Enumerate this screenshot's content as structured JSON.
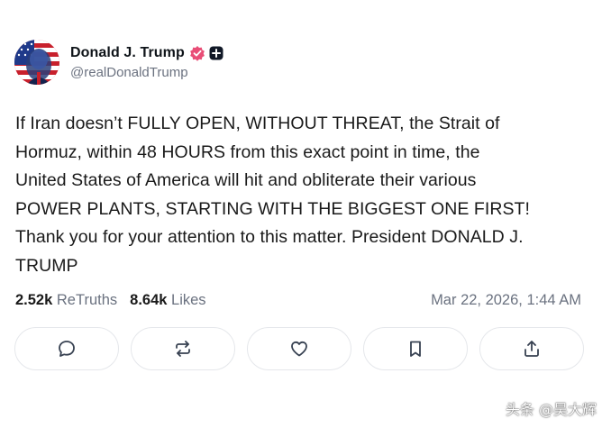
{
  "post": {
    "author": {
      "display_name": "Donald J. Trump",
      "handle": "@realDonaldTrump",
      "verified_badge": "verified-check-icon",
      "verified_color": "#e94e77",
      "plus_badge": "plus-badge-icon"
    },
    "body_lines": [
      "If Iran doesn’t FULLY OPEN, WITHOUT THREAT, the Strait of",
      "Hormuz, within 48 HOURS from this exact point in time, the",
      "United States of America will hit and obliterate their various",
      "POWER PLANTS, STARTING WITH THE BIGGEST ONE FIRST!",
      "Thank you for your attention to this matter. President DONALD J.",
      "TRUMP"
    ],
    "stats": {
      "retruths_count": "2.52k",
      "retruths_label": "ReTruths",
      "likes_count": "8.64k",
      "likes_label": "Likes"
    },
    "timestamp": "Mar 22, 2026, 1:44 AM",
    "actions": [
      {
        "name": "reply",
        "icon": "reply-bubble-icon"
      },
      {
        "name": "retruth",
        "icon": "retruth-arrows-icon"
      },
      {
        "name": "like",
        "icon": "heart-icon"
      },
      {
        "name": "bookmark",
        "icon": "bookmark-icon"
      },
      {
        "name": "share",
        "icon": "share-upload-icon"
      }
    ]
  },
  "watermark": "头条 @昊大辉",
  "colors": {
    "text": "#0f1419",
    "muted": "#6b7280",
    "border": "#e5e7eb"
  }
}
